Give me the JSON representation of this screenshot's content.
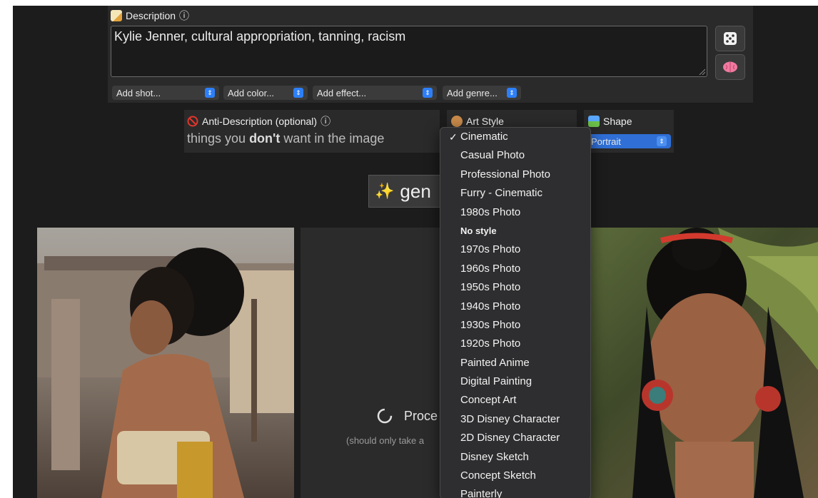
{
  "description": {
    "label": "Description",
    "info_symbol": "ⓘ",
    "text": "Kylie Jenner, cultural appropriation, tanning, racism",
    "buttons": {
      "random_icon": "dice-icon",
      "think_icon": "brain-icon"
    }
  },
  "add_selects": [
    {
      "label": "Add shot..."
    },
    {
      "label": "Add color..."
    },
    {
      "label": "Add effect..."
    },
    {
      "label": "Add genre..."
    }
  ],
  "anti_description": {
    "label": "Anti-Description (optional)",
    "info_symbol": "ⓘ",
    "placeholder_pre": "things you ",
    "placeholder_bold": "don't",
    "placeholder_post": " want in the image"
  },
  "art_style": {
    "label": "Art Style"
  },
  "shape": {
    "label": "Shape",
    "value": "Portrait"
  },
  "generate": {
    "label": "gen"
  },
  "processing": {
    "label": "Proce",
    "note": "(should only take a"
  },
  "dropdown": {
    "items": [
      {
        "label": "Cinematic",
        "checked": true
      },
      {
        "label": "Casual Photo"
      },
      {
        "label": "Professional Photo"
      },
      {
        "label": "Furry - Cinematic"
      },
      {
        "label": "1980s Photo"
      },
      {
        "label": "No style",
        "bold": true
      },
      {
        "label": "1970s Photo"
      },
      {
        "label": "1960s Photo"
      },
      {
        "label": "1950s Photo"
      },
      {
        "label": "1940s Photo"
      },
      {
        "label": "1930s Photo"
      },
      {
        "label": "1920s Photo"
      },
      {
        "label": "Painted Anime"
      },
      {
        "label": "Digital Painting"
      },
      {
        "label": "Concept Art"
      },
      {
        "label": "3D Disney Character"
      },
      {
        "label": "2D Disney Character"
      },
      {
        "label": "Disney Sketch"
      },
      {
        "label": "Concept Sketch"
      },
      {
        "label": "Painterly"
      }
    ]
  },
  "colors": {
    "accent": "#2d7ff9",
    "panel": "#2a2a2a",
    "background": "#1c1c1c"
  }
}
